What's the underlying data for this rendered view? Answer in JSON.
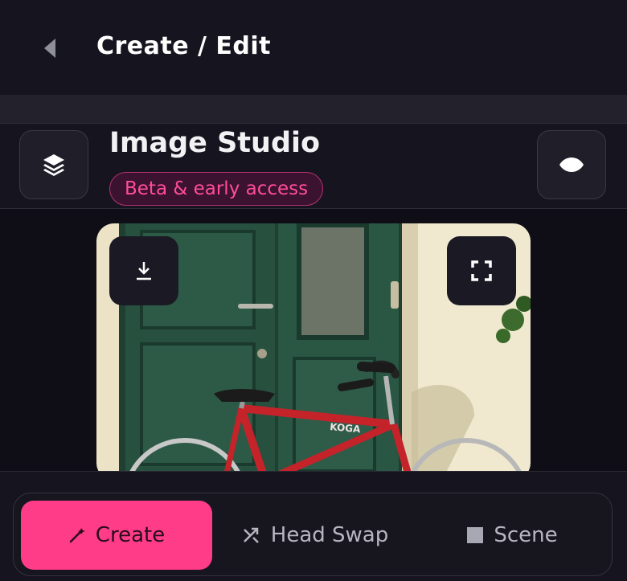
{
  "header": {
    "title": "Create / Edit",
    "back_icon": "chevron-left-icon"
  },
  "studio": {
    "title": "Image Studio",
    "badge": "Beta & early access",
    "layers_icon": "layers-icon",
    "preview_icon": "eye-icon"
  },
  "preview": {
    "download_icon": "download-icon",
    "fullscreen_icon": "fullscreen-icon",
    "bike_brand": "KOGA"
  },
  "tabs": [
    {
      "label": "Create",
      "icon": "magic-wand-icon",
      "active": true
    },
    {
      "label": "Head Swap",
      "icon": "swap-icon",
      "active": false
    },
    {
      "label": "Scene",
      "icon": "square-icon",
      "active": false
    }
  ],
  "colors": {
    "accent": "#ff3c87",
    "background": "#0f0e16",
    "badge_text": "#ff4d9a"
  }
}
